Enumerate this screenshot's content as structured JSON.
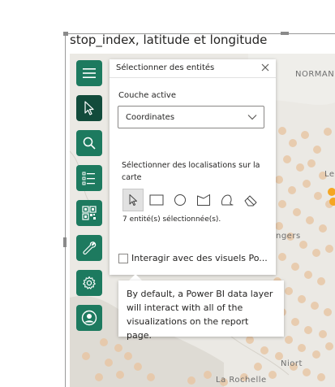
{
  "visual": {
    "title": "stop_index, latitude et longitude"
  },
  "map": {
    "labels": {
      "normandy": "NORMAN",
      "le": "Le",
      "angers": "ngers",
      "niort": "Niort",
      "la_rochelle": "La Rochelle"
    },
    "colors": {
      "background": "#e9e7e2",
      "points": "#e8c7a6",
      "highlight": "#f39c12"
    }
  },
  "toolbar": {
    "accent": "#1d7a5f",
    "active_accent": "#124b3b",
    "buttons": [
      {
        "icon": "menu-icon"
      },
      {
        "icon": "cursor-icon"
      },
      {
        "icon": "search-icon"
      },
      {
        "icon": "list-filter-icon"
      },
      {
        "icon": "qr-layers-icon"
      },
      {
        "icon": "wrench-icon"
      },
      {
        "icon": "gear-icon"
      },
      {
        "icon": "user-icon"
      }
    ]
  },
  "panel": {
    "title": "Sélectionner des entités",
    "active_layer_label": "Couche active",
    "active_layer_value": "Coordinates",
    "select_locations_label": "Sélectionner des localisations sur la carte",
    "tools": [
      {
        "icon": "pointer-tool-icon"
      },
      {
        "icon": "rectangle-tool-icon"
      },
      {
        "icon": "circle-tool-icon"
      },
      {
        "icon": "polygon-tool-icon"
      },
      {
        "icon": "lasso-tool-icon"
      },
      {
        "icon": "eraser-tool-icon"
      }
    ],
    "selection_count_text": "7 entité(s) sélectionnée(s).",
    "interact_label": "Interagir avec des visuels Po..."
  },
  "tooltip": {
    "text": "By default, a Power BI data layer will interact with all of the visualizations on the report page."
  }
}
